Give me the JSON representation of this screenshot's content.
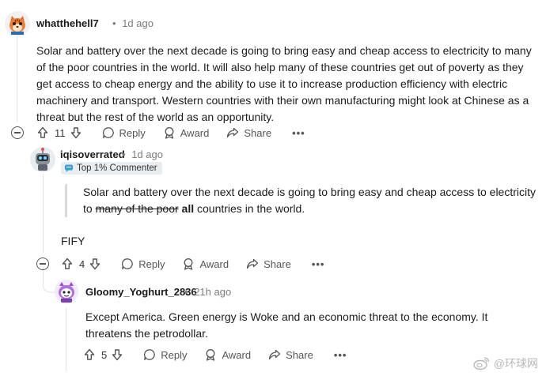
{
  "comments": [
    {
      "username": "whatthehell7",
      "separator": "•",
      "time": "1d ago",
      "body": "Solar and battery over the next decade is going to bring easy and cheap access to electricity to many of the poor countries in the world. It will also help many of these countries get out of poverty as they get access to cheap energy and the ability to use it to increase production efficiency with electric machinery and transport. Western countries with their own manufacturing might look at Chinese as a threat but the rest of the world as an opportunity.",
      "votes": "11"
    },
    {
      "username": "iqisoverrated",
      "separator": "•",
      "time": "1d ago",
      "badge": "Top 1% Commenter",
      "quote_before": "Solar and battery over the next decade is going to bring easy and cheap access to electricity to ",
      "quote_struck": "many of the poor",
      "quote_bold": "all",
      "quote_after": " countries in the world.",
      "body": "FIFY",
      "votes": "4"
    },
    {
      "username": "Gloomy_Yoghurt_2836",
      "separator": "•",
      "time": "21h ago",
      "body": "Except America. Green energy is Woke and an economic threat to the economy. It threatens the petrodollar.",
      "votes": "5"
    }
  ],
  "actions": {
    "reply": "Reply",
    "award": "Award",
    "share": "Share",
    "more": "•••"
  },
  "watermark": "@环球网"
}
